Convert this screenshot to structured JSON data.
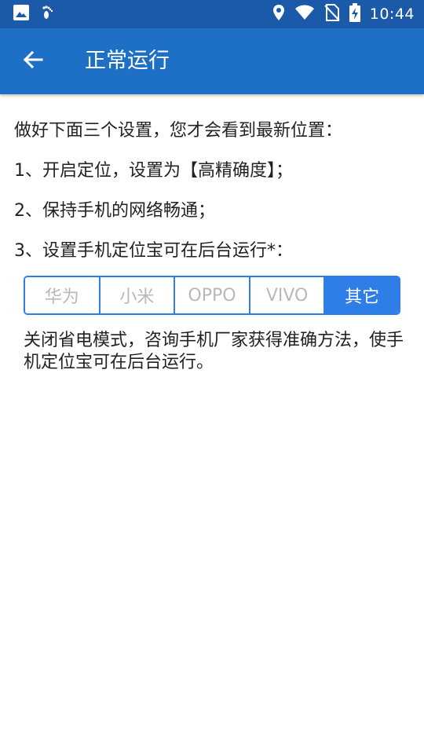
{
  "status_bar": {
    "time": "10:44",
    "icons": [
      "image-icon",
      "footprints-icon",
      "location-icon",
      "wifi-icon",
      "no-sim-icon",
      "battery-charging-icon"
    ]
  },
  "app_bar": {
    "back_icon": "arrow-left-icon",
    "title": "正常运行"
  },
  "content": {
    "intro": "做好下面三个设置，您才会看到最新位置：",
    "steps": [
      "1、开启定位，设置为【高精确度】；",
      "2、保持手机的网络畅通；",
      "3、设置手机定位宝可在后台运行*："
    ]
  },
  "brand_tabs": {
    "options": [
      "华为",
      "小米",
      "OPPO",
      "VIVO",
      "其它"
    ],
    "selected": "其它",
    "colors": {
      "accent": "#2f7ee8",
      "unselected_text": "#b8b8b8"
    }
  },
  "description": "关闭省电模式，咨询手机厂家获得准确方法，使手机定位宝可在后台运行。",
  "colors": {
    "status_bar": "#1a5aa8",
    "app_bar": "#1e6fc6",
    "text": "#222222"
  }
}
